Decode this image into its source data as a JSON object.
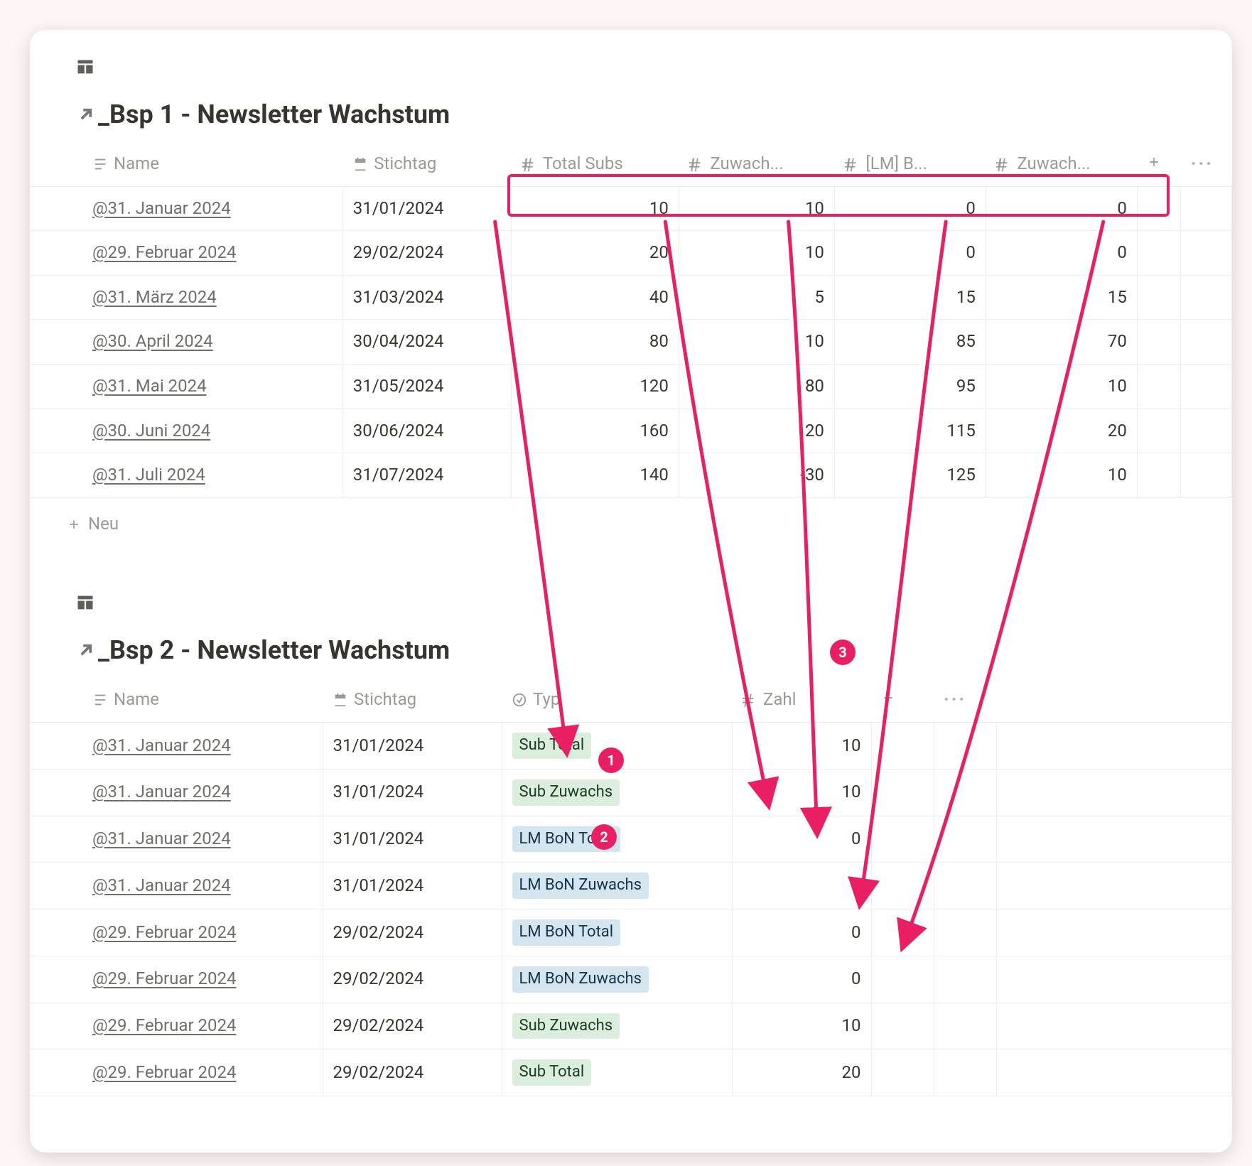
{
  "view_icon_name": "table-icon",
  "block1": {
    "title": "_Bsp 1 - Newsletter Wachstum",
    "columns": [
      {
        "label": "Name",
        "type": "title"
      },
      {
        "label": "Stichtag",
        "type": "date"
      },
      {
        "label": "Total Subs",
        "type": "number"
      },
      {
        "label": "Zuwach...",
        "type": "number"
      },
      {
        "label": "[LM] B...",
        "type": "number"
      },
      {
        "label": "Zuwach...",
        "type": "number"
      }
    ],
    "rows": [
      {
        "name": "@31. Januar 2024",
        "date": "31/01/2024",
        "v": [
          10,
          10,
          0,
          0
        ]
      },
      {
        "name": "@29. Februar 2024",
        "date": "29/02/2024",
        "v": [
          20,
          10,
          0,
          0
        ]
      },
      {
        "name": "@31. März 2024",
        "date": "31/03/2024",
        "v": [
          40,
          5,
          15,
          15
        ]
      },
      {
        "name": "@30. April 2024",
        "date": "30/04/2024",
        "v": [
          80,
          10,
          85,
          70
        ]
      },
      {
        "name": "@31. Mai 2024",
        "date": "31/05/2024",
        "v": [
          120,
          80,
          95,
          10
        ]
      },
      {
        "name": "@30. Juni 2024",
        "date": "30/06/2024",
        "v": [
          160,
          20,
          115,
          20
        ]
      },
      {
        "name": "@31. Juli 2024",
        "date": "31/07/2024",
        "v": [
          140,
          -30,
          125,
          10
        ]
      }
    ],
    "add_row_label": "Neu"
  },
  "block2": {
    "title": "_Bsp 2 - Newsletter Wachstum",
    "columns": [
      {
        "label": "Name",
        "type": "title"
      },
      {
        "label": "Stichtag",
        "type": "date"
      },
      {
        "label": "Typ",
        "type": "select"
      },
      {
        "label": "Zahl",
        "type": "number"
      }
    ],
    "rows": [
      {
        "name": "@31. Januar 2024",
        "date": "31/01/2024",
        "typ": {
          "label": "Sub Total",
          "color": "green"
        },
        "zahl": 10
      },
      {
        "name": "@31. Januar 2024",
        "date": "31/01/2024",
        "typ": {
          "label": "Sub Zuwachs",
          "color": "green"
        },
        "zahl": 10
      },
      {
        "name": "@31. Januar 2024",
        "date": "31/01/2024",
        "typ": {
          "label": "LM BoN Total",
          "color": "blue"
        },
        "zahl": 0
      },
      {
        "name": "@31. Januar 2024",
        "date": "31/01/2024",
        "typ": {
          "label": "LM BoN Zuwachs",
          "color": "blue"
        },
        "zahl": 0
      },
      {
        "name": "@29. Februar 2024",
        "date": "29/02/2024",
        "typ": {
          "label": "LM BoN Total",
          "color": "blue"
        },
        "zahl": 0
      },
      {
        "name": "@29. Februar 2024",
        "date": "29/02/2024",
        "typ": {
          "label": "LM BoN Zuwachs",
          "color": "blue"
        },
        "zahl": 0
      },
      {
        "name": "@29. Februar 2024",
        "date": "29/02/2024",
        "typ": {
          "label": "Sub Zuwachs",
          "color": "green"
        },
        "zahl": 10
      },
      {
        "name": "@29. Februar 2024",
        "date": "29/02/2024",
        "typ": {
          "label": "Sub Total",
          "color": "green"
        },
        "zahl": 20
      }
    ]
  },
  "annotations": {
    "callouts": [
      "1",
      "2",
      "3"
    ]
  }
}
